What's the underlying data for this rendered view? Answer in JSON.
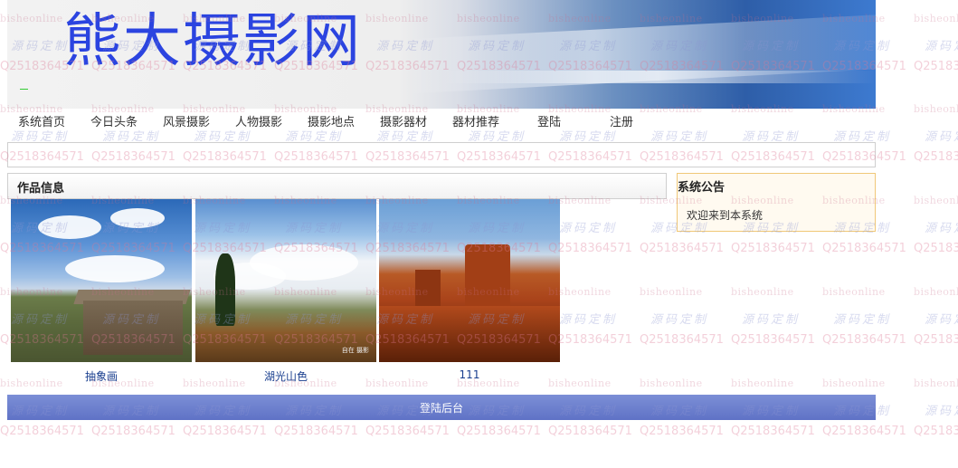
{
  "site": {
    "title": "熊大摄影网"
  },
  "nav": {
    "items": [
      "系统首页",
      "今日头条",
      "风景摄影",
      "人物摄影",
      "摄影地点",
      "摄影器材",
      "器材推荐",
      "登陆",
      "注册"
    ]
  },
  "works": {
    "heading": "作品信息",
    "items": [
      {
        "caption": "抽象画"
      },
      {
        "caption": "湖光山色",
        "photo_mark": "自在 摄影"
      },
      {
        "caption": "111"
      }
    ]
  },
  "notice": {
    "heading": "系统公告",
    "content": "欢迎来到本系统"
  },
  "footer": {
    "admin_link": "登陆后台"
  },
  "watermark": {
    "line_a": "bisheonline",
    "line_b": "源码定制",
    "line_c": "Q2518364571"
  },
  "colors": {
    "title": "#2b44e0",
    "footer_bar": "#6a7ccc",
    "notice_border": "#f0c878",
    "caption_link": "#1a3f8f"
  }
}
